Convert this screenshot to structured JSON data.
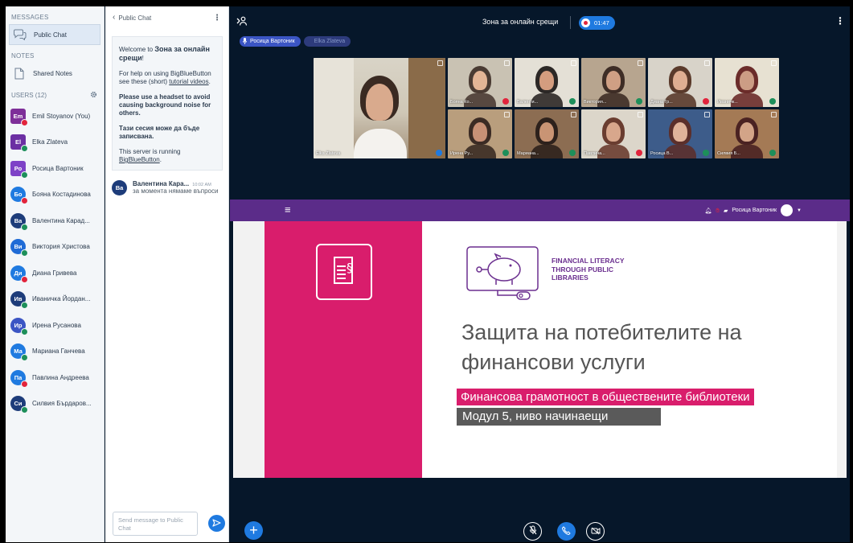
{
  "sidebar": {
    "messages_title": "MESSAGES",
    "public_chat_label": "Public Chat",
    "notes_title": "NOTES",
    "shared_notes_label": "Shared Notes",
    "users_title": "USERS (12)",
    "users": [
      {
        "initials": "Em",
        "name": "Emil Stoyanov (You)",
        "color": "#7e2f99",
        "status": "#e2243c"
      },
      {
        "initials": "El",
        "name": "Elka Zlateva",
        "color": "#6b2fa3",
        "status": "#1d8f5a"
      },
      {
        "initials": "Ро",
        "name": "Росица Вартоник",
        "color": "#7e42c7",
        "status": "#1d8f5a"
      },
      {
        "initials": "Бо",
        "name": "Бояна Костадинова",
        "color": "#1f7ae0",
        "status": "#e2243c"
      },
      {
        "initials": "Ва",
        "name": "Валентина Карад...",
        "color": "#1d3c7a",
        "status": "#1d8f5a"
      },
      {
        "initials": "Ви",
        "name": "Виктория Христова",
        "color": "#1f6bd6",
        "status": "#1d8f5a"
      },
      {
        "initials": "Ди",
        "name": "Диана Гривева",
        "color": "#1f7ae0",
        "status": "#e2243c"
      },
      {
        "initials": "Ив",
        "name": "Иваничка Йордан...",
        "color": "#1d3c7a",
        "status": "#1d8f5a"
      },
      {
        "initials": "Ир",
        "name": "Ирена Русанова",
        "color": "#3b55c4",
        "status": "#1d8f5a"
      },
      {
        "initials": "Ма",
        "name": "Мариана Ганчева",
        "color": "#1f7ae0",
        "status": "#1d8f5a"
      },
      {
        "initials": "Па",
        "name": "Павлина Андреева",
        "color": "#1f7ae0",
        "status": "#e2243c"
      },
      {
        "initials": "Си",
        "name": "Силвия Бърдаров...",
        "color": "#1d3c7a",
        "status": "#1d8f5a"
      }
    ]
  },
  "chat": {
    "header_label": "Public Chat",
    "back_icon": "chevron-left-icon",
    "welcome_line1": "Welcome to ",
    "welcome_title": "Зона за онлайн срещи",
    "welcome_excl": "!",
    "help_text": "For help on using BigBlueButton see these (short) ",
    "tutorial_link": "tutorial videos",
    "help_end": ".",
    "headset_tip": "Please use a headset to avoid causing background noise for others.",
    "recorded_note": "Тази сесия може да бъде записвана.",
    "server_text": "This server is running ",
    "server_link": "BigBlueButton",
    "server_end": ".",
    "message": {
      "initials": "Ва",
      "author": "Валентина Кара...",
      "time": "10:02 AM",
      "text": "за момента нямаме въпроси"
    },
    "input_placeholder": "Send message to Public Chat"
  },
  "main": {
    "meeting_title": "Зона за онлайн срещи",
    "recording_time": "01:47",
    "talking": [
      "Росица Вартоник",
      "Elka Zlateva"
    ],
    "webcams": [
      {
        "label": "Elka Zlateva",
        "status": "#1f7ae0"
      },
      {
        "label": "Бояна Ко...",
        "status": "#e2243c"
      },
      {
        "label": "Валенти...",
        "status": "#1d8f5a"
      },
      {
        "label": "Виктория...",
        "status": "#1d8f5a"
      },
      {
        "label": "Диана Гр...",
        "status": "#e2243c"
      },
      {
        "label": "Иваничк...",
        "status": "#1d8f5a"
      },
      {
        "label": "Ирена Ру...",
        "status": "#1d8f5a"
      },
      {
        "label": "Мариана...",
        "status": "#1d8f5a"
      },
      {
        "label": "Павлина...",
        "status": "#e2243c"
      },
      {
        "label": "Росица В...",
        "status": "#1d8f5a"
      },
      {
        "label": "Силвия Б...",
        "status": "#1d8f5a"
      }
    ],
    "presenter_name": "Росица Вартоник"
  },
  "slide": {
    "fin_line1": "FINANCIAL LITERACY",
    "fin_line2": "THROUGH PUBLIC",
    "fin_line3": "LIBRARIES",
    "title_line1": "Защита на потебителите на",
    "title_line2": "финансови услуги",
    "subtitle1": "Финансова грамотност в обществените библиотеки",
    "subtitle2": "Модул 5, ниво начинаещи"
  },
  "colors": {
    "primary_blue": "#1f7ae0",
    "presentation_bar": "#5b2c89",
    "slide_pink": "#d91d6c",
    "slide_purple": "#6b2f8f",
    "dark_bg": "#06172a"
  }
}
